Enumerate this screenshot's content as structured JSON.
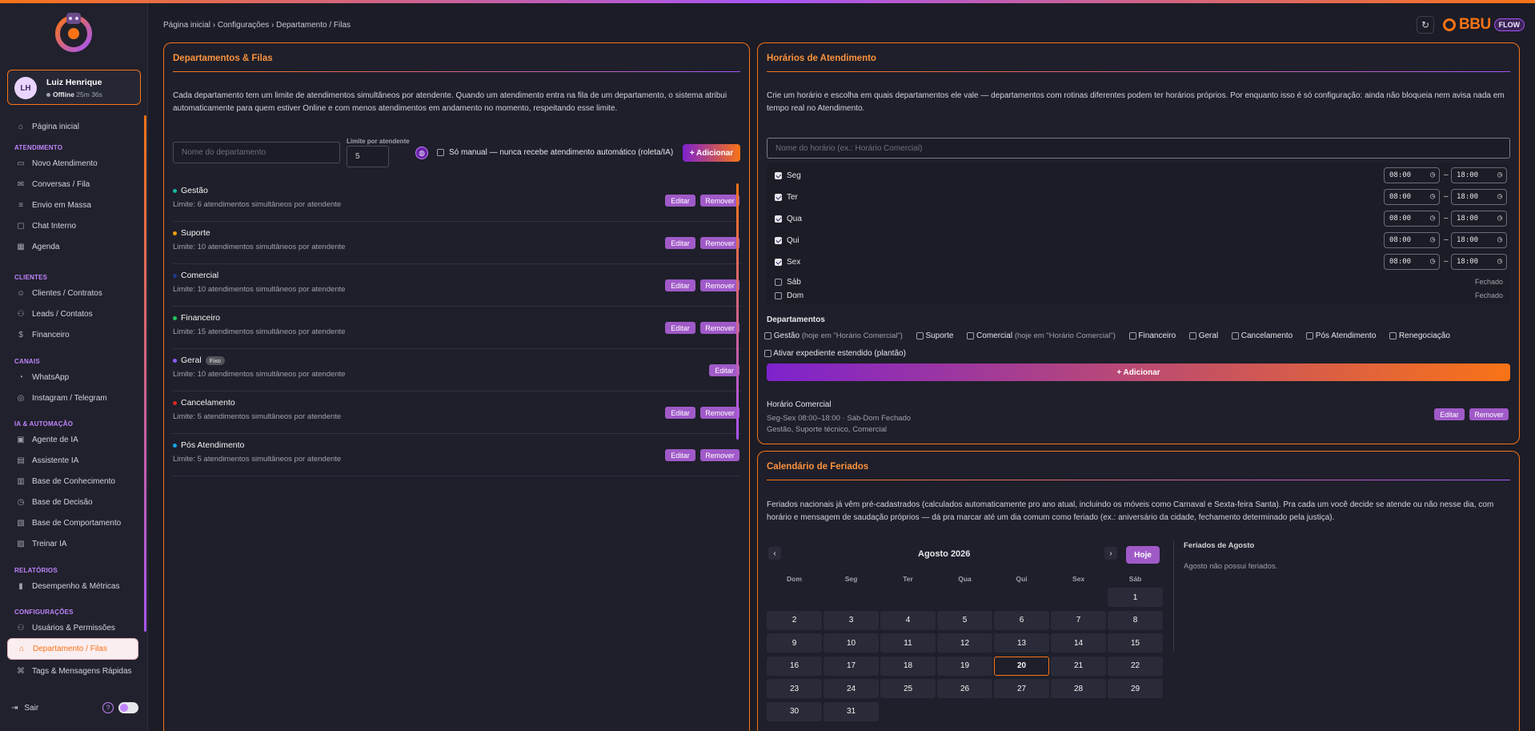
{
  "breadcrumb": "Página inicial › Configurações › Departamento / Filas",
  "brand": {
    "name": "BBU",
    "badge": "FLOW",
    "accent": "#f97316"
  },
  "user": {
    "initials": "LH",
    "name": "Luiz Henrique",
    "status": "Offline",
    "duration": "25m 36s"
  },
  "sidebar": {
    "home": "Página inicial",
    "sections": {
      "atendimento": "ATENDIMENTO",
      "clientes": "CLIENTES",
      "canais": "CANAIS",
      "ia": "IA & AUTOMAÇÃO",
      "relatorios": "RELATÓRIOS",
      "config": "CONFIGURAÇÕES"
    },
    "items": {
      "novo": "Novo Atendimento",
      "conversas": "Conversas / Fila",
      "envio": "Envio em Massa",
      "chat": "Chat Interno",
      "agenda": "Agenda",
      "clientes": "Clientes / Contratos",
      "leads": "Leads / Contatos",
      "financeiro": "Financeiro",
      "whatsapp": "WhatsApp",
      "instagram": "Instagram / Telegram",
      "agente": "Agente de IA",
      "assistente": "Assistente IA",
      "conhecimento": "Base de Conhecimento",
      "decisao": "Base de Decisão",
      "comportamento": "Base de Comportamento",
      "treinar": "Treinar IA",
      "desempenho": "Desempenho & Métricas",
      "usuarios": "Usuários & Permissões",
      "departamento": "Departamento / Filas",
      "tags": "Tags & Mensagens Rápidas"
    },
    "logout": "Sair"
  },
  "departments_panel": {
    "title": "Departamentos & Filas",
    "description": "Cada departamento tem um limite de atendimentos simultâneos por atendente. Quando um atendimento entra na fila de um departamento, o sistema atribui automaticamente para quem estiver Online e com menos atendimentos em andamento no momento, respeitando esse limite.",
    "name_placeholder": "Nome do departamento",
    "limit_label": "Limite por atendente",
    "limit_value": "5",
    "manual_label": "Só manual — nunca recebe atendimento automático (roleta/IA)",
    "add_label": "+ Adicionar",
    "edit_label": "Editar",
    "remove_label": "Remover",
    "fixed_label": "Fixo",
    "items": [
      {
        "name": "Gestão",
        "limit": "Limite: 6 atendimentos simultâneos por atendente",
        "color": "#14b8a6"
      },
      {
        "name": "Suporte",
        "limit": "Limite: 10 atendimentos simultâneos por atendente",
        "color": "#f59e0b"
      },
      {
        "name": "Comercial",
        "limit": "Limite: 10 atendimentos simultâneos por atendente",
        "color": "#1e3a8a"
      },
      {
        "name": "Financeiro",
        "limit": "Limite: 15 atendimentos simultâneos por atendente",
        "color": "#22c55e"
      },
      {
        "name": "Geral",
        "limit": "Limite: 10 atendimentos simultâneos por atendente",
        "color": "#8b5cf6"
      },
      {
        "name": "Cancelamento",
        "limit": "Limite: 5 atendimentos simultâneos por atendente",
        "color": "#dc2626"
      },
      {
        "name": "Pós Atendimento",
        "limit": "Limite: 5 atendimentos simultâneos por atendente",
        "color": "#0ea5e9"
      }
    ]
  },
  "hours_panel": {
    "title": "Horários de Atendimento",
    "description": "Crie um horário e escolha em quais departamentos ele vale — departamentos com rotinas diferentes podem ter horários próprios. Por enquanto isso é só configuração: ainda não bloqueia nem avisa nada em tempo real no Atendimento.",
    "name_placeholder": "Nome do horário (ex.: Horário Comercial)",
    "days": [
      {
        "label": "Seg",
        "start": "08:00",
        "end": "18:00"
      },
      {
        "label": "Ter",
        "start": "08:00",
        "end": "18:00"
      },
      {
        "label": "Qua",
        "start": "08:00",
        "end": "18:00"
      },
      {
        "label": "Qui",
        "start": "08:00",
        "end": "18:00"
      },
      {
        "label": "Sex",
        "start": "08:00",
        "end": "18:00"
      },
      {
        "label": "Sáb",
        "closed": "Fechado"
      },
      {
        "label": "Dom",
        "closed": "Fechado"
      }
    ],
    "departments_label": "Departamentos",
    "dept_options": {
      "gestao": "Gestão",
      "gestao_note": "(hoje em \"Horário Comercial\")",
      "suporte": "Suporte",
      "comercial": "Comercial",
      "comercial_note": "(hoje em \"Horário Comercial\")",
      "financeiro": "Financeiro",
      "geral": "Geral",
      "cancelamento": "Cancelamento",
      "pos": "Pós Atendimento",
      "renegociacao": "Renegociação"
    },
    "extended_label": "Ativar expediente estendido (plantão)",
    "add_label": "+ Adicionar",
    "saved": {
      "name": "Horário Comercial",
      "schedule": "Seg-Sex 08:00–18:00 · Sáb-Dom Fechado",
      "departments": "Gestão, Suporte técnico, Comercial",
      "edit": "Editar",
      "remove": "Remover"
    }
  },
  "holidays_panel": {
    "title": "Calendário de Feriados",
    "description": "Feriados nacionais já vêm pré-cadastrados (calculados automaticamente pro ano atual, incluindo os móveis como Carnaval e Sexta-feira Santa). Pra cada um você decide se atende ou não nesse dia, com horário e mensagem de saudação próprios — dá pra marcar até um dia comum como feriado (ex.: aniversário da cidade, fechamento determinado pela justiça).",
    "month_label": "Agosto 2026",
    "today_button": "Hoje",
    "weekdays": [
      "Dom",
      "Seg",
      "Ter",
      "Qua",
      "Qui",
      "Sex",
      "Sáb"
    ],
    "first_weekday": 6,
    "days_in_month": 31,
    "today": 20,
    "holidays_title": "Feriados de Agosto",
    "holidays_empty": "Agosto não possui feriados."
  }
}
